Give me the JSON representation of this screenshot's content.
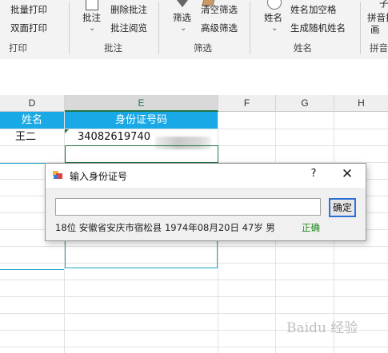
{
  "ribbon": {
    "print_group": {
      "items": [
        "批量打印",
        "双面打印"
      ],
      "label": "打印"
    },
    "annotate_group": {
      "big_button": "批注",
      "items": [
        "删除批注",
        "批注阅览"
      ],
      "label": "批注"
    },
    "filter_group": {
      "big_button": "筛选",
      "items": [
        "清空筛选",
        "高级筛选"
      ],
      "label": "筛选"
    },
    "name_group": {
      "big_button": "姓名",
      "items": [
        "姓名加空格",
        "生成随机姓名"
      ],
      "label": "姓名"
    },
    "pinyin_group": {
      "big_button_line1": "拼音指",
      "big_button_line2": "画",
      "label": "拼音"
    }
  },
  "sheet": {
    "columns": [
      "D",
      "E",
      "F",
      "G",
      "H"
    ],
    "header_row": {
      "name": "姓名",
      "id": "身份证号码"
    },
    "row1": {
      "name": "王二",
      "id": "34082619740"
    }
  },
  "dialog": {
    "title": "输入身份证号",
    "help": "?",
    "close": "✕",
    "input_value": "",
    "ok_label": "确定",
    "info": "18位  安徽省安庆市宿松县  1974年08月20日  47岁  男",
    "status": "正确"
  },
  "watermark": "Baidu 经验",
  "colors": {
    "header_blue": "#19a9e6",
    "excel_green": "#217346",
    "status_green": "#1e8a1e",
    "ok_border": "#2a6fd6"
  }
}
